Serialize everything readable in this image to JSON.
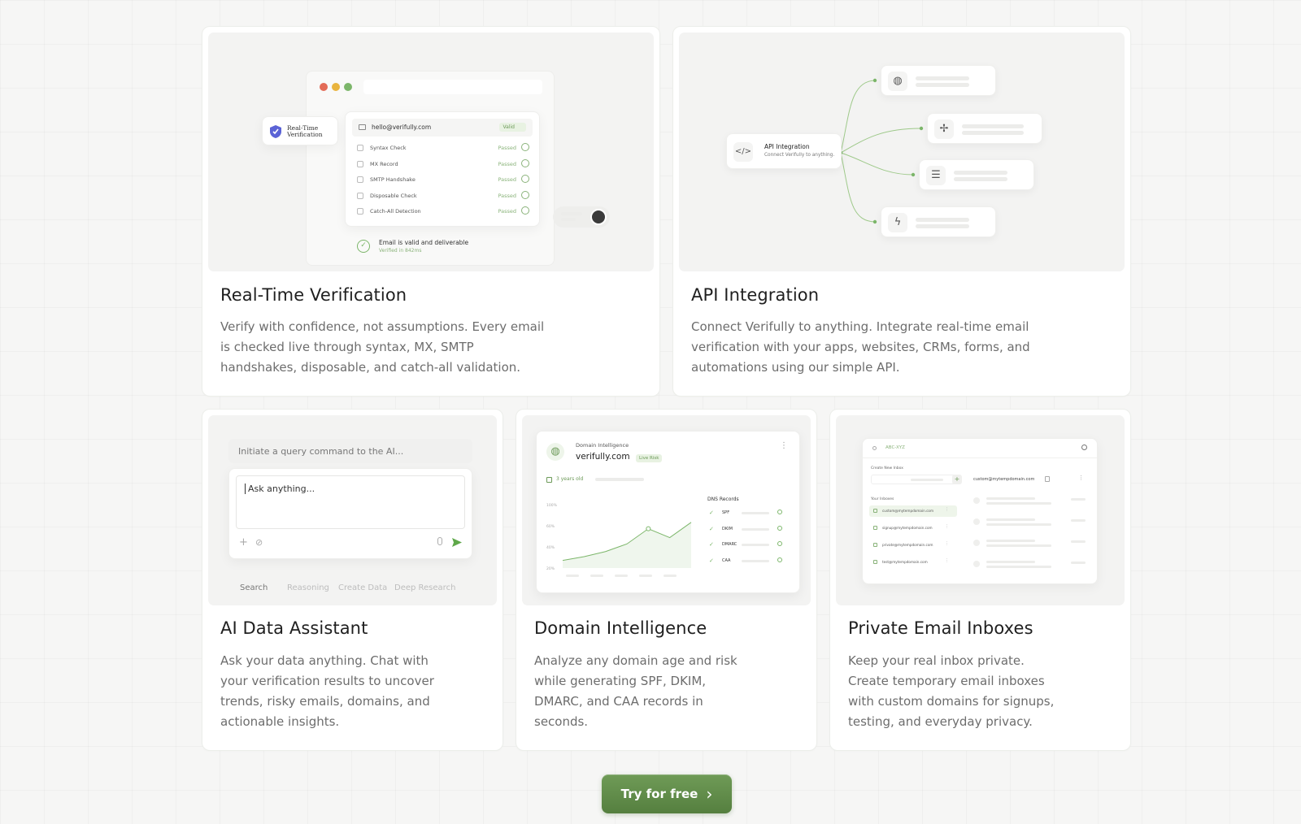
{
  "cards": {
    "realtime": {
      "title": "Real-Time Verification",
      "description": "Verify with confidence, not assumptions. Every email is checked live through syntax, MX, SMTP handshakes, disposable, and catch-all validation.",
      "preview": {
        "badge": "Real-Time Verification",
        "email": "hello@verifully.com",
        "valid_badge": "Valid",
        "checks": [
          {
            "label": "Syntax Check",
            "status": "Passed"
          },
          {
            "label": "MX Record",
            "status": "Passed"
          },
          {
            "label": "SMTP Handshake",
            "status": "Passed"
          },
          {
            "label": "Disposable Check",
            "status": "Passed"
          },
          {
            "label": "Catch-All Detection",
            "status": "Passed"
          }
        ],
        "result_title": "Email is valid and deliverable",
        "result_sub": "Verified in 842ms"
      }
    },
    "api": {
      "title": "API Integration",
      "description": "Connect Verifully to anything. Integrate real-time email verification with your apps, websites, CRMs, forms, and automations using our simple API.",
      "preview": {
        "node_title": "API Integration",
        "node_sub": "Connect Verifully to anything."
      }
    },
    "assistant": {
      "title": "AI Data Assistant",
      "description": "Ask your data anything. Chat with your verification results to uncover trends, risky emails, domains, and actionable insights.",
      "preview": {
        "query_placeholder": "Initiate a query command to the AI...",
        "input_placeholder": "Ask anything...",
        "tabs": [
          "Search",
          "Reasoning",
          "Create Data",
          "Deep Research"
        ]
      }
    },
    "domain": {
      "title": "Domain Intelligence",
      "description": "Analyze any domain age and risk while generating SPF, DKIM, DMARC, and CAA records in seconds.",
      "preview": {
        "label": "Domain Intelligence",
        "domain": "verifully.com",
        "live_badge": "Live Risk",
        "age": "3 years old",
        "dns_title": "DNS Records",
        "records": [
          "SPF",
          "DKIM",
          "DMARC",
          "CAA"
        ],
        "y_ticks": [
          "100%",
          "60%",
          "40%",
          "20%"
        ],
        "trend": [
          0.12,
          0.18,
          0.26,
          0.38,
          0.62,
          0.48,
          0.72
        ]
      }
    },
    "inboxes": {
      "title": "Private Email Inboxes",
      "description": "Keep your real inbox private. Create temporary email inboxes with custom domains for signups, testing, and everyday privacy.",
      "preview": {
        "header_chip": "ABC-XYZ",
        "create_label": "Create New Inbox",
        "current_address": "custom@mytempdomain.com",
        "list_label": "Your Inboxes",
        "inboxes": [
          "custom@mytempdomain.com",
          "signup@mytempdomain.com",
          "private@mytempdomain.com",
          "test@mytempdomain.com"
        ]
      }
    }
  },
  "cta": {
    "label": "Try for free",
    "arrow": "›"
  },
  "colors": {
    "accent": "#5f8a48",
    "valid": "#8ab37a",
    "background": "#f6f6f5"
  }
}
